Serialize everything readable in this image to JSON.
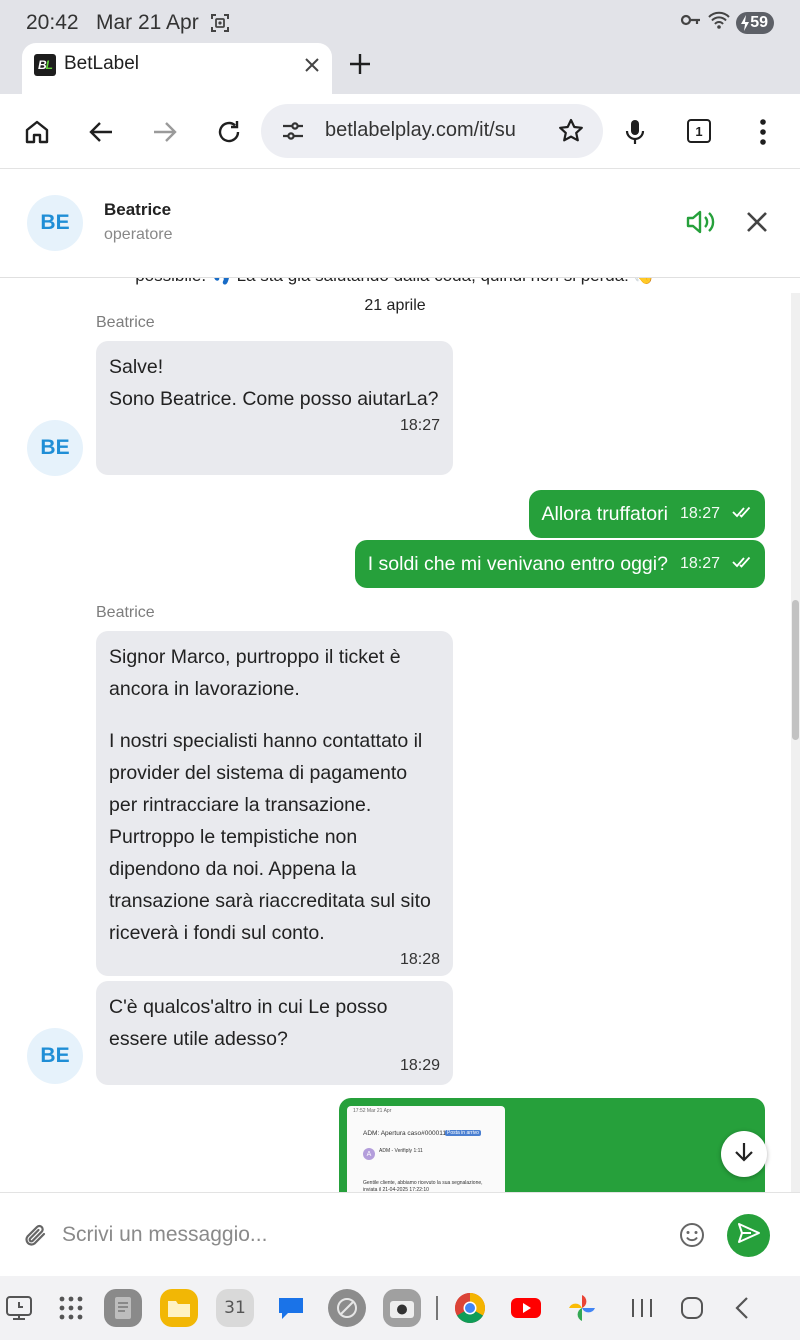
{
  "status_bar": {
    "time": "20:42",
    "date": "Mar 21 Apr",
    "battery": "59"
  },
  "browser": {
    "tab_title": "BetLabel",
    "favicon_text": "BL",
    "url": "betlabelplay.com/it/su",
    "tab_count": "1"
  },
  "chat": {
    "header": {
      "avatar_initials": "BE",
      "agent_name": "Beatrice",
      "agent_role": "operatore"
    },
    "cut_off_text": "possibile. 👣 La sta già salutando dalla coda, quindi non si perda! 👋",
    "date_separator": "21 aprile",
    "messages": [
      {
        "sender": "Beatrice",
        "paragraphs": [
          "Salve!\nSono Beatrice. Come posso aiutarLa?"
        ],
        "time": "18:27"
      },
      {
        "text": "Allora truffatori",
        "time": "18:27"
      },
      {
        "text": "I soldi che mi venivano entro oggi?",
        "time": "18:27"
      },
      {
        "sender": "Beatrice",
        "paragraphs": [
          "Signor Marco, purtroppo il ticket è ancora in lavorazione.",
          "I nostri specialisti hanno contattato il provider del sistema di pagamento per rintracciare la transazione. Purtroppo le tempistiche non dipendono da noi. Appena la transazione sarà riaccreditata sul sito riceverà i fondi sul conto."
        ],
        "time": "18:28"
      },
      {
        "paragraphs": [
          "C'è qualcos'altro in cui Le posso essere utile adesso?"
        ],
        "time": "18:29"
      }
    ],
    "image_preview": {
      "status": "17:52 Mar 21 Apr",
      "subject": "ADM: Apertura caso#00001195",
      "label": "Posta in arrivo",
      "avatar": "A",
      "sender": "ADM - Verifiply 1:11",
      "body": "Gentile cliente, abbiamo ricevuto la sua segnalazione, inviata il 21-04-2025 17:22:10"
    },
    "composer": {
      "placeholder": "Scrivi un messaggio..."
    }
  },
  "taskbar": {
    "calendar_day": "31"
  },
  "colors": {
    "accent_green": "#26a03b",
    "incoming_bubble": "#e9eaee",
    "avatar_text": "#1f8ed6",
    "avatar_bg": "#e6f2fb"
  },
  "icons": [
    "screenshot-icon",
    "key-icon",
    "wifi-icon",
    "home-icon",
    "back-icon",
    "forward-icon",
    "reload-icon",
    "site-settings-icon",
    "star-icon",
    "mic-icon",
    "more-icon",
    "speaker-icon",
    "close-icon",
    "read-receipt-icon",
    "arrow-down-icon",
    "attach-icon",
    "emoji-icon",
    "send-icon"
  ]
}
